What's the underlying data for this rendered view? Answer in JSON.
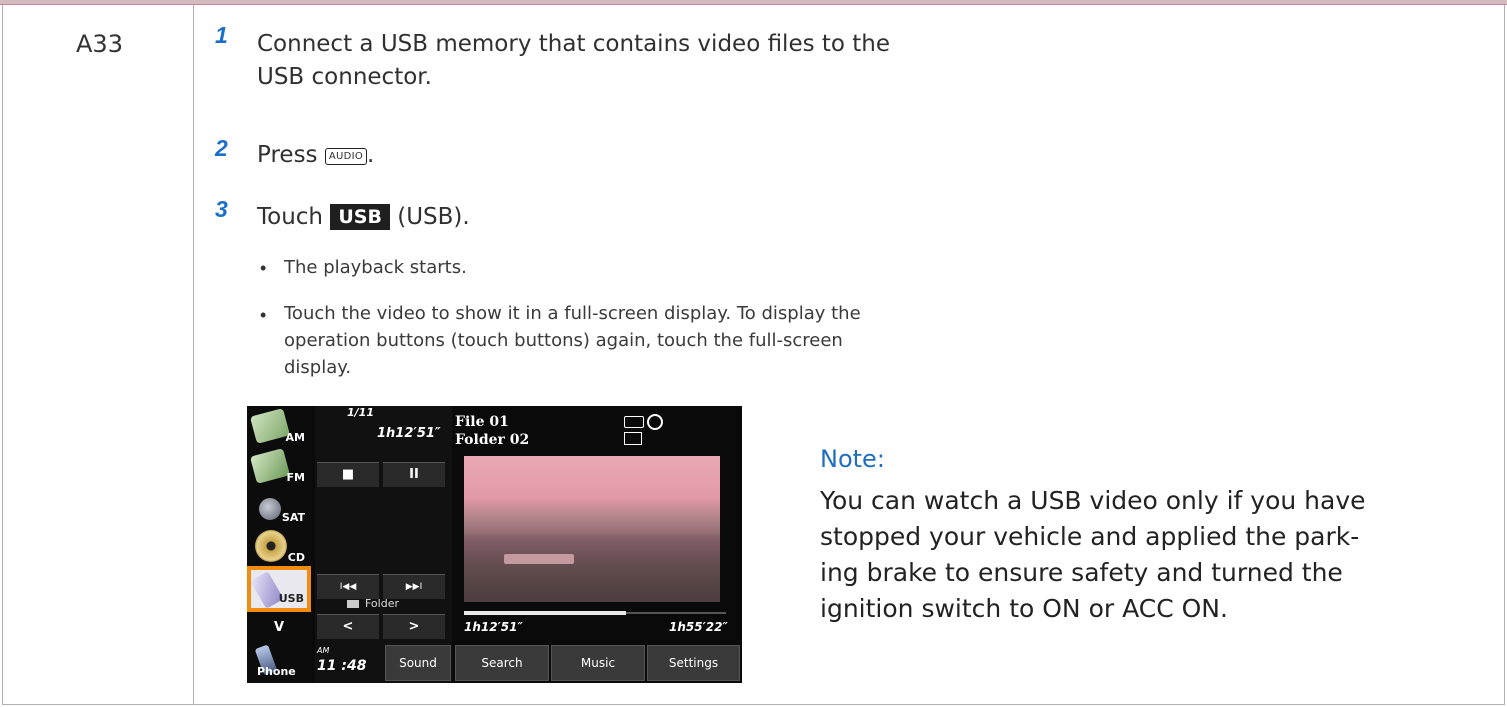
{
  "question_id": "A33",
  "steps": [
    {
      "number": "1",
      "line1": "Connect a USB memory that contains video files to the",
      "line2": "USB connector."
    },
    {
      "number": "2",
      "text": "Press",
      "key": "AUDIO",
      "after": "."
    },
    {
      "number": "3",
      "text": "Touch",
      "tag": "USB",
      "after": "(USB)."
    }
  ],
  "bullets": [
    {
      "lines": [
        "The playback starts."
      ]
    },
    {
      "lines": [
        "Touch the video to show it in a full-screen display. To display the",
        "operation buttons (touch buttons) again, touch the full-screen",
        "display."
      ]
    }
  ],
  "bullet_symbol": "•",
  "screen": {
    "track": "1/11",
    "elapsed_top": "1h12′51″",
    "file": "File 01",
    "folder": "Folder 02",
    "sources": [
      "AM",
      "FM",
      "SAT",
      "CD",
      "USB"
    ],
    "phone": "Phone",
    "chevron": "V",
    "stop_symbol": "■",
    "pause_symbol": "II",
    "prev_symbol": "I◀◀",
    "next_symbol": "▶▶I",
    "folder_label": "Folder",
    "folder_down": "<",
    "folder_up": ">",
    "time_prefix": "AM",
    "clock": "11 :48",
    "sound": "Sound",
    "elapsed": "1h12′51″",
    "total": "1h55′22″",
    "progress": 0.62,
    "search": "Search",
    "music": "Music",
    "settings": "Settings"
  },
  "note": {
    "title": "Note:",
    "lines": [
      "You can watch a USB video only if you have",
      "stopped your vehicle and applied the park-",
      "ing brake to ensure safety and turned the",
      "ignition switch to ON or ACC ON."
    ]
  }
}
